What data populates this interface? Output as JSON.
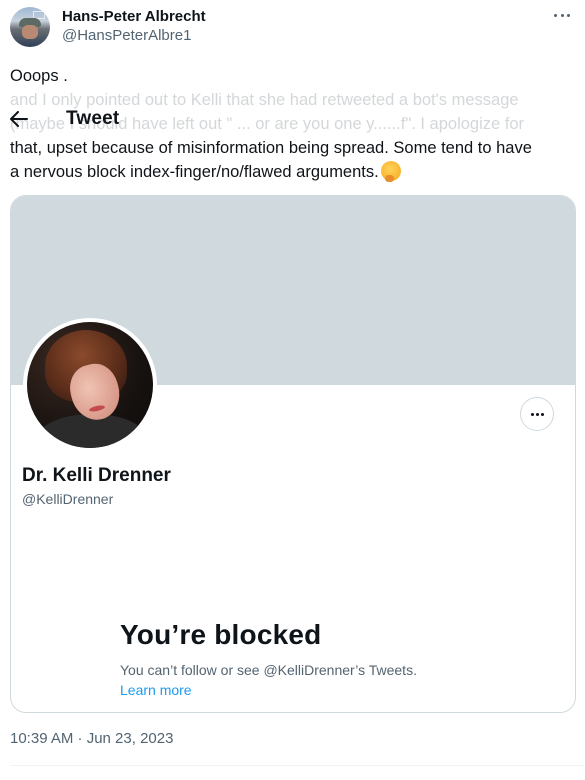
{
  "header": {
    "title": "Tweet",
    "back_icon": "arrow-left-icon"
  },
  "author": {
    "name": "Hans-Peter Albrecht",
    "handle": "@HansPeterAlbre1",
    "more_icon": "more-horizontal-icon"
  },
  "tweet": {
    "lines": [
      "Ooops .",
      "and I only pointed out to Kelli that she had retweeted a bot's message",
      "(maybe I should have left out \" ... or are you one y......f\".  I apologize for",
      "that, upset because of misinformation being spread. Some tend to have",
      "a nervous block index-finger/no/flawed arguments."
    ],
    "emoji": "thinking-face-emoji",
    "timestamp": "10:39 AM · Jun 23, 2023"
  },
  "embedded_profile": {
    "name": "Dr. Kelli Drenner",
    "handle": "@KelliDrenner",
    "blocked_title": "You’re blocked",
    "blocked_description": "You can’t follow or see @KelliDrenner’s Tweets.",
    "learn_more_label": "Learn more",
    "banner_color": "#cfd9de",
    "link_color": "#1d9bf0"
  }
}
